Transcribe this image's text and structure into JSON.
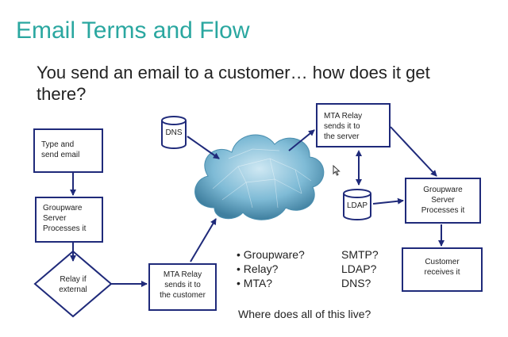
{
  "slide": {
    "title": "Email Terms and Flow",
    "subtitle": "You send an email to a customer… how does it get there?",
    "closing": "Where does all of this live?"
  },
  "nodes": {
    "type_send": "Type and\nsend email",
    "groupware_left": "Groupware\nServer\nProcesses it",
    "relay_external": "Relay if\nexternal",
    "mta_relay_customer": "MTA Relay\nsends it to\nthe customer",
    "dns": "DNS",
    "mta_relay_server": "MTA Relay\nsends it to\nthe server",
    "ldap": "LDAP",
    "groupware_right": "Groupware\nServer\nProcesses it",
    "customer": "Customer\nreceives it"
  },
  "questions": {
    "left": [
      "• Groupware?",
      "• Relay?",
      "• MTA?"
    ],
    "right": [
      "SMTP?",
      "LDAP?",
      "DNS?"
    ]
  },
  "colors": {
    "title": "#2aa7a0",
    "box_border": "#1f2a7a",
    "arrow": "#1f2a7a",
    "cloud": "#5fa9c9"
  },
  "icons": {
    "cloud": "internet-cloud-icon",
    "cylinder": "database-cylinder-icon",
    "pointer": "mouse-pointer-icon"
  }
}
